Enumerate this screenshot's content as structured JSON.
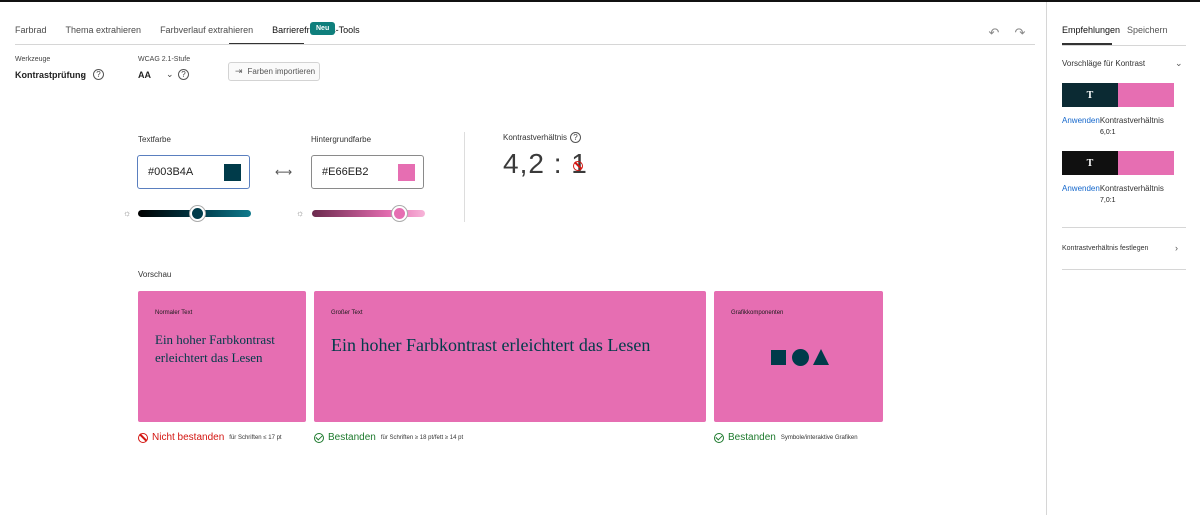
{
  "tabs": [
    "Farbrad",
    "Thema extrahieren",
    "Farbverlauf extrahieren",
    "Barrierefreiheits-Tools"
  ],
  "badge": "Neu",
  "tools": {
    "tools_label": "Werkzeuge",
    "tools_value": "Kontrastprüfung",
    "wcag_label": "WCAG 2.1-Stufe",
    "wcag_value": "AA",
    "import_label": "Farben importieren"
  },
  "text_color": {
    "label": "Textfarbe",
    "value": "#003B4A",
    "hex": "#003B4A",
    "slider_level": 0.53
  },
  "bg_color": {
    "label": "Hintergrundfarbe",
    "value": "#E66EB2",
    "hex": "#E66EB2",
    "slider_level": 0.78
  },
  "contrast": {
    "label": "Kontrastverhältnis",
    "value": "4,2 : 1",
    "status": "fail"
  },
  "preview": {
    "title": "Vorschau",
    "cards": [
      {
        "caption": "Normaler Text",
        "text": "Ein hoher Farbkontrast erleichtert das Lesen",
        "status": "Nicht bestanden",
        "status_type": "fail",
        "note": "für Schriften ≤ 17 pt"
      },
      {
        "caption": "Großer Text",
        "text": "Ein hoher Farbkontrast erleichtert das Lesen",
        "status": "Bestanden",
        "status_type": "pass",
        "note": "für Schriften ≥ 18 pt/fett ≥ 14 pt"
      },
      {
        "caption": "Grafikkomponenten",
        "status": "Bestanden",
        "status_type": "pass",
        "note": "Symbole/interaktive Grafiken"
      }
    ]
  },
  "right_panel": {
    "tabs": [
      "Empfehlungen",
      "Speichern"
    ],
    "section_title": "Vorschläge für Kontrast",
    "suggestions": [
      {
        "fg_hex": "#0b2a33",
        "letter": "T",
        "apply": "Anwenden",
        "label": "Kontrastverhältnis",
        "ratio": "6,0:1"
      },
      {
        "fg_hex": "#101010",
        "letter": "T",
        "apply": "Anwenden",
        "label": "Kontrastverhältnis",
        "ratio": "7,0:1"
      }
    ],
    "set_ratio_link": "Kontrastverhältnis festlegen"
  },
  "colors": {
    "pass": "#1d7a2d",
    "fail": "#d31510",
    "accent_badge": "#0f7f7c",
    "link": "#1467cc"
  }
}
